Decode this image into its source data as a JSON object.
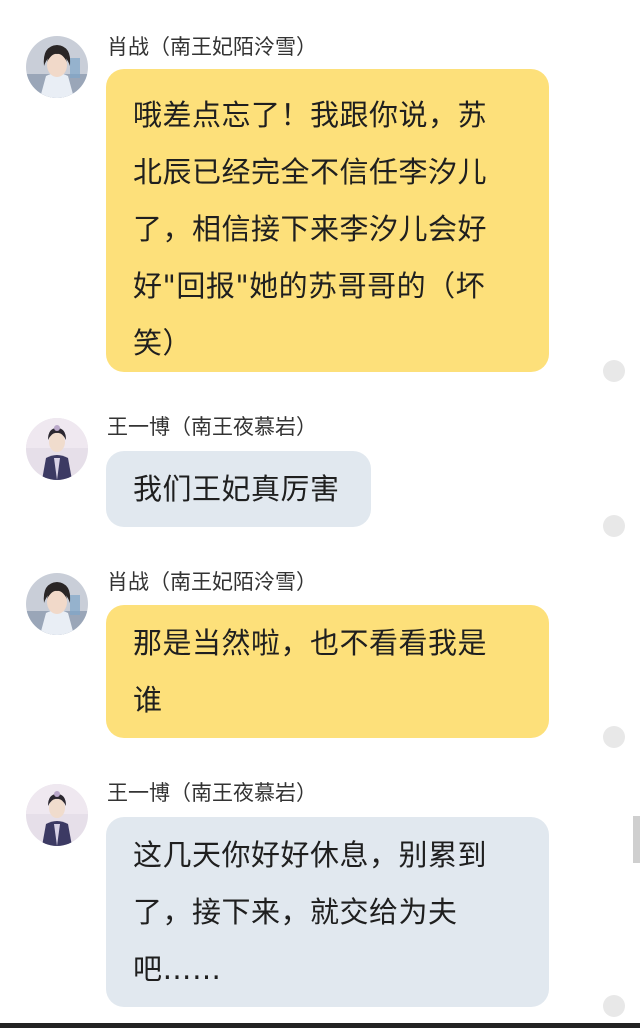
{
  "messages": [
    {
      "sender": "肖战（南王妃陌泠雪）",
      "avatar_icon": "xiaozhan-avatar-icon",
      "bubble_color": "#fde07a",
      "lines": [
        "哦差点忘了！我跟你说，苏",
        "北辰已经完全不信任李汐儿",
        "了，相信接下来李汐儿会好",
        "好\"回报\"她的苏哥哥的（坏",
        "笑）"
      ]
    },
    {
      "sender": "王一博（南王夜慕岩）",
      "avatar_icon": "wangyibo-avatar-icon",
      "bubble_color": "#e1e8ef",
      "lines": [
        "我们王妃真厉害"
      ]
    },
    {
      "sender": "肖战（南王妃陌泠雪）",
      "avatar_icon": "xiaozhan-avatar-icon",
      "bubble_color": "#fde07a",
      "lines": [
        "那是当然啦，也不看看我是",
        "谁"
      ]
    },
    {
      "sender": "王一博（南王夜慕岩）",
      "avatar_icon": "wangyibo-avatar-icon",
      "bubble_color": "#e1e8ef",
      "lines": [
        "这几天你好好休息，别累到",
        "了，接下来，就交给为夫",
        "吧……"
      ]
    }
  ]
}
